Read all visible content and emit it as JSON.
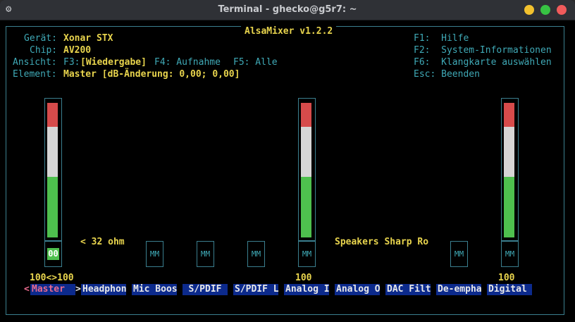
{
  "window": {
    "title": "Terminal - ghecko@g5r7: ~"
  },
  "app": {
    "title": "AlsaMixer v1.2.2"
  },
  "info": {
    "device_label": "Gerät:",
    "device_value": "Xonar STX",
    "chip_label": "Chip:",
    "chip_value": "AV200",
    "view_label": "Ansicht:",
    "view_f3": "F3:",
    "view_current": "[Wiedergabe]",
    "view_f4": "F4: Aufnahme",
    "view_f5": "F5: Alle",
    "element_label": "Element:",
    "element_value": "Master [dB-Änderung: 0,00; 0,00]"
  },
  "help": {
    "f1": "F1:  Hilfe",
    "f2": "F2:  System-Informationen",
    "f6": "F6:  Klangkarte auswählen",
    "esc": "Esc: Beenden"
  },
  "controls": {
    "master": {
      "level_percent": 100,
      "value_text": "100<>100",
      "mute": "00"
    },
    "headphone_impedance": "< 32 ohm",
    "analog_level_text": "100",
    "analog_level_percent": 100,
    "speakers_text": "Speakers Sharp Ro",
    "digital_level_text": "100",
    "digital_level_percent": 100,
    "mute_label": "MM"
  },
  "tabs": [
    {
      "label": "Master"
    },
    {
      "label": "Headphon"
    },
    {
      "label": "Mic Boos"
    },
    {
      "label": "S/PDIF"
    },
    {
      "label": "S/PDIF L"
    },
    {
      "label": "Analog I"
    },
    {
      "label": "Analog O"
    },
    {
      "label": "DAC Filt"
    },
    {
      "label": "De-empha"
    },
    {
      "label": "Digital"
    }
  ],
  "tab_arrows": {
    "left": "<",
    "right": ">"
  },
  "colors": {
    "cyan": "#3fa9b6",
    "yellow": "#e8d44d",
    "red": "#d64b4b",
    "green": "#4ec04e",
    "tab_bg": "#0c2a8c"
  }
}
